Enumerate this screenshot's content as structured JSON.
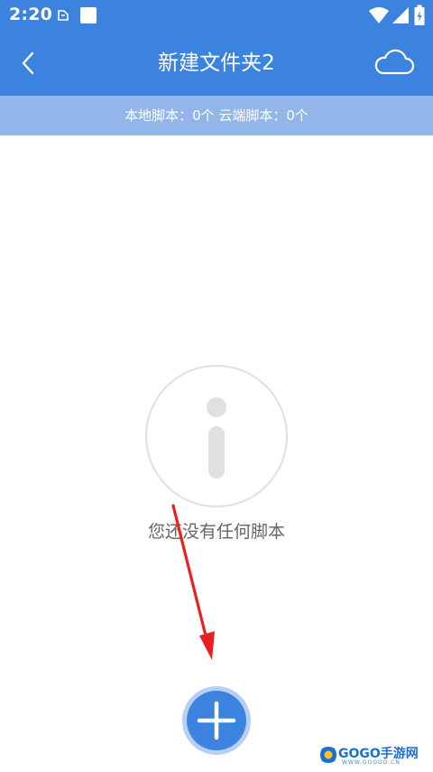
{
  "status_bar": {
    "time": "2:20",
    "icons": [
      "notification-cloud-icon",
      "app-square-icon",
      "wifi-icon",
      "signal-icon",
      "battery-icon"
    ]
  },
  "header": {
    "title": "新建文件夹2",
    "back_icon": "chevron-left-icon",
    "cloud_icon": "cloud-icon"
  },
  "summary": {
    "text": "本地脚本：0个 云端脚本：0个"
  },
  "empty_state": {
    "icon": "info-icon",
    "message": "您还没有任何脚本"
  },
  "fab": {
    "icon": "plus-icon"
  },
  "watermark": {
    "text": "GOGO手游网",
    "subtext": "WWW.GOGOO.CN"
  },
  "colors": {
    "primary": "#3c83e0",
    "summary_bar": "#93b6ea",
    "arrow": "#e82020",
    "empty_icon": "#e0e0e0"
  }
}
